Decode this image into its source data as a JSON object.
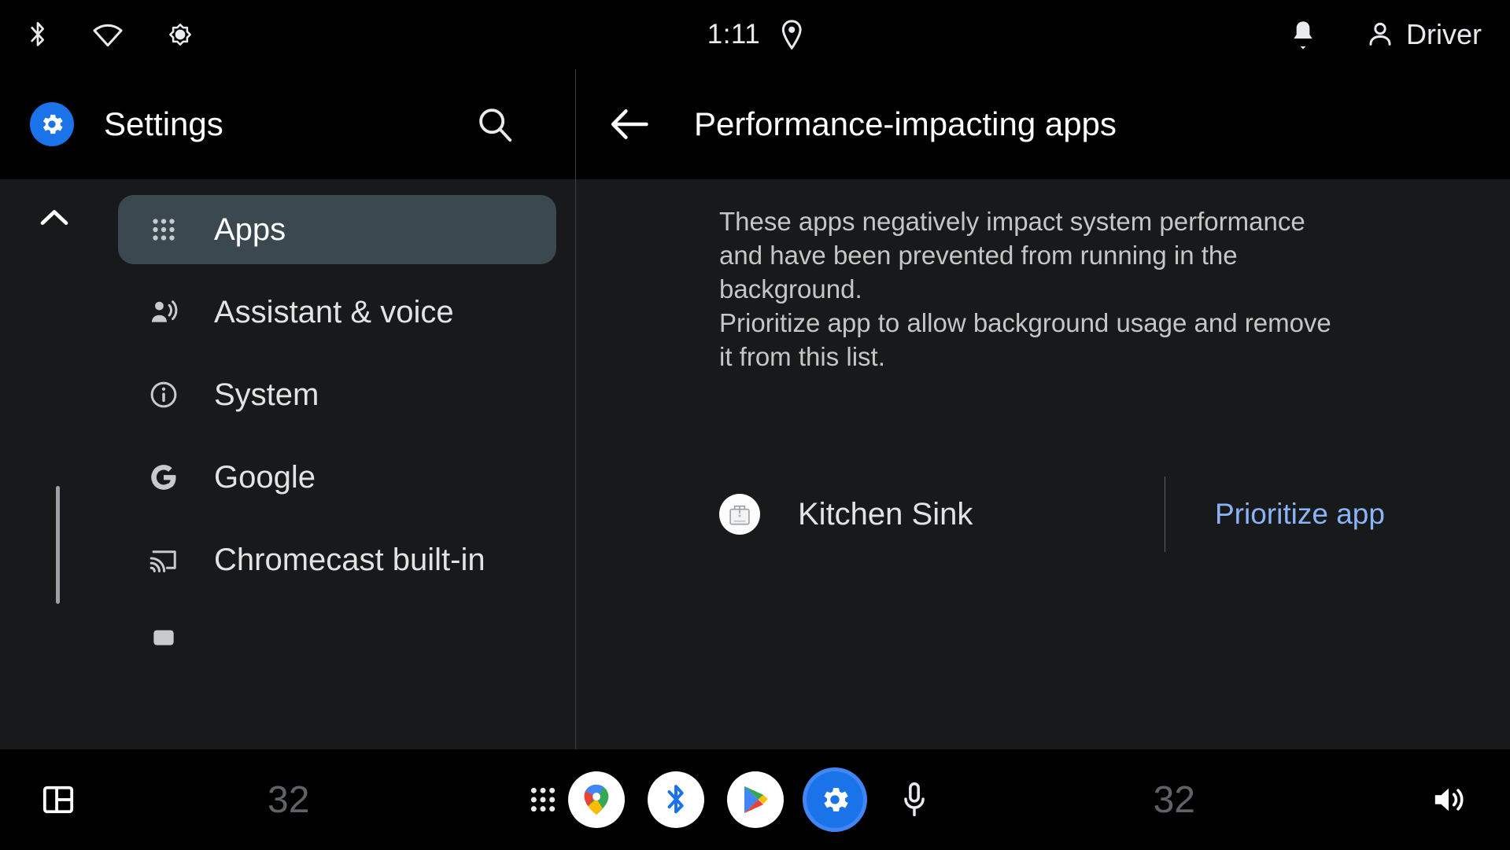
{
  "status_bar": {
    "left_icons": [
      {
        "name": "bluetooth-icon"
      },
      {
        "name": "wifi-icon"
      },
      {
        "name": "brightness-icon"
      }
    ],
    "clock": "1:11",
    "location_icon": "location-pin-icon",
    "notification_icon": "notification-bell-icon",
    "user_icon": "person-icon",
    "user_name": "Driver"
  },
  "sidebar": {
    "logo_icon": "settings-gear-icon",
    "title": "Settings",
    "search_icon": "search-icon",
    "scroll_up_icon": "chevron-up-icon",
    "scroll_down_icon": "chevron-down-icon",
    "items": [
      {
        "label": "Apps",
        "icon": "apps-grid-icon",
        "selected": true
      },
      {
        "label": "Assistant & voice",
        "icon": "assistant-voice-icon",
        "selected": false
      },
      {
        "label": "System",
        "icon": "info-circle-icon",
        "selected": false
      },
      {
        "label": "Google",
        "icon": "google-g-icon",
        "selected": false
      },
      {
        "label": "Chromecast built-in",
        "icon": "cast-icon",
        "selected": false
      }
    ]
  },
  "main": {
    "back_icon": "back-arrow-icon",
    "title": "Performance-impacting apps",
    "description_lines": [
      "These apps negatively impact system performance and have been prevented from running in the background.",
      "Prioritize app to allow background usage and remove it from this list."
    ],
    "app": {
      "icon": "kitchen-sink-app-icon",
      "name": "Kitchen Sink",
      "action_label": "Prioritize app"
    }
  },
  "taskbar": {
    "dashboard_icon": "dashboard-layout-icon",
    "temp_left": "32",
    "grid_icon": "app-grid-icon",
    "apps": [
      {
        "name": "maps-app-icon"
      },
      {
        "name": "bluetooth-app-icon"
      },
      {
        "name": "play-store-app-icon"
      },
      {
        "name": "settings-app-icon"
      },
      {
        "name": "microphone-icon"
      }
    ],
    "temp_right": "32",
    "volume_icon": "volume-icon"
  },
  "colors": {
    "accent_blue": "#1a73e8",
    "link_blue": "#8ab4f8",
    "selected_bg": "#3b4850",
    "panel_bg": "#17191a",
    "bar_bg": "#000000"
  }
}
